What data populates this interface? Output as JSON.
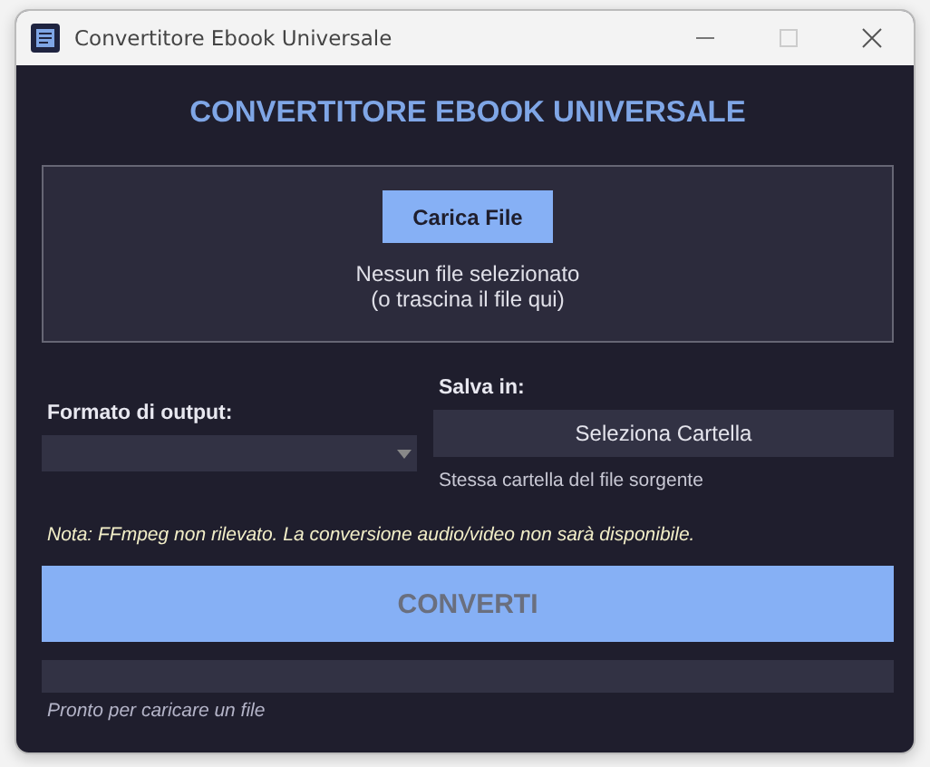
{
  "window": {
    "title": "Convertitore Ebook Universale"
  },
  "heading": "CONVERTITORE EBOOK UNIVERSALE",
  "drop_zone": {
    "button": "Carica File",
    "status": "Nessun file selezionato",
    "hint": "(o trascina il file qui)"
  },
  "output_format": {
    "label": "Formato di output:"
  },
  "save_in": {
    "label": "Salva in:",
    "button": "Seleziona Cartella",
    "path": "Stessa cartella del file sorgente"
  },
  "note": "Nota: FFmpeg non rilevato. La conversione audio/video non sarà disponibile.",
  "convert_button": {
    "label": "CONVERTI",
    "disabled": true
  },
  "progress": {
    "level": 0
  },
  "status": "Pronto per caricare un file"
}
